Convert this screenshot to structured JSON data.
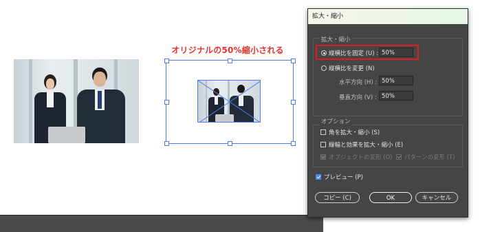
{
  "annotation": "オリジナルの50%縮小される",
  "dialog": {
    "title": "拡大・縮小",
    "scale_group_label": "拡大・縮小",
    "uniform_label": "縦横比を固定 (U) :",
    "uniform_value": "50%",
    "non_uniform_label": "縦横比を変更 (N)",
    "horizontal_label": "水平方向 (H) :",
    "horizontal_value": "50%",
    "vertical_label": "垂直方向 (V) :",
    "vertical_value": "50%",
    "options_group_label": "オプション",
    "scale_corners_label": "角を拡大・縮小 (S)",
    "scale_strokes_label": "線幅と効果を拡大・縮小 (E)",
    "transform_objects_label": "オブジェクトの変形 (O)",
    "transform_patterns_label": "パターンの変形 (T)",
    "preview_label": "プレビュー (P)",
    "copy_button": "コピー (C)",
    "ok_button": "OK",
    "cancel_button": "キャンセル",
    "uniform_selected": true,
    "preview_checked": true
  },
  "colors": {
    "annotation": "#e8322d",
    "selection": "#4d7cf0",
    "dialog_bg": "#454545",
    "highlight_box": "#e01b1b"
  }
}
